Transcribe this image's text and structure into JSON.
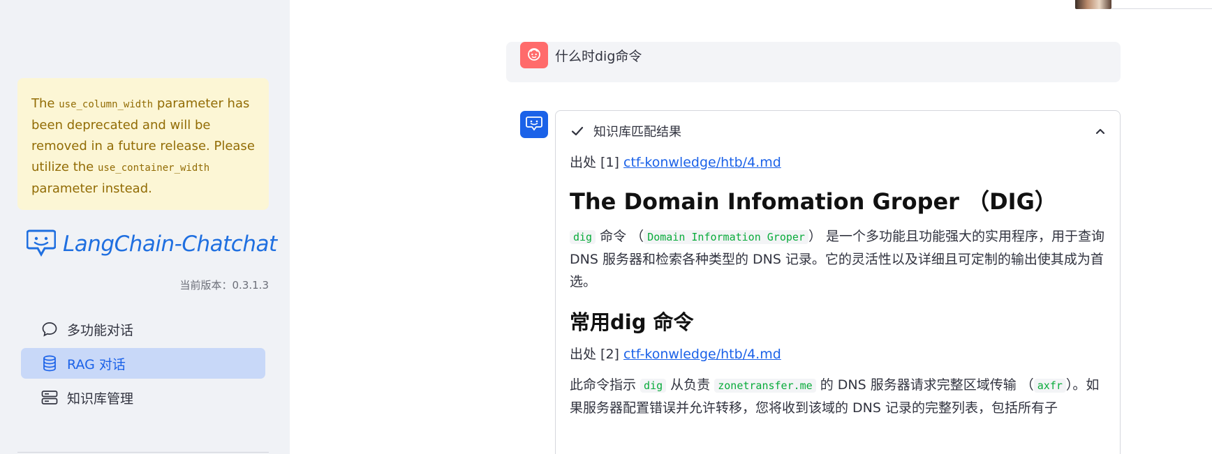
{
  "sidebar": {
    "warning": {
      "prefix": "The",
      "code1": "use_column_width",
      "middle": "parameter has been deprecated and will be removed in a future release. Please utilize the",
      "code2": "use_container_width",
      "suffix": "parameter instead."
    },
    "logo_text": "LangChain-Chatchat",
    "version": "当前版本：0.3.1.3",
    "nav": [
      {
        "label": "多功能对话",
        "icon": "chat-bubble-icon"
      },
      {
        "label": "RAG 对话",
        "icon": "database-icon"
      },
      {
        "label": "知识库管理",
        "icon": "server-stack-icon"
      }
    ],
    "active_index": 1
  },
  "chat": {
    "user_message": "什么时dig命令",
    "panel_title": "知识库匹配结果",
    "source1_prefix": "出处 [1]",
    "source1_link": "ctf-konwledge/htb/4.md",
    "heading1": "The Domain Infomation Groper （DIG）",
    "para1": {
      "code1": "dig",
      "t1": " 命令 （",
      "code2": "Domain Information Groper",
      "t2": "） 是一个多功能且功能强大的实用程序，用于查询 DNS 服务器和检索各种类型的 DNS 记录。它的灵活性以及详细且可定制的输出使其成为首选。"
    },
    "heading2": "常用dig 命令",
    "source2_prefix": "出处 [2]",
    "source2_link": "ctf-konwledge/htb/4.md",
    "para2": {
      "t1": "此命令指示 ",
      "code1": "dig",
      "t2": " 从负责 ",
      "code2": "zonetransfer.me",
      "t3": " 的 DNS 服务器请求完整区域传输 （",
      "code3": "axfr",
      "t4": "）。如果服务器配置错误并允许转移，您将收到该域的 DNS 记录的完整列表，包括所有子"
    }
  },
  "colors": {
    "accent": "#1b62e8",
    "user_avatar": "#ff6b6b",
    "warning_bg": "#fcf6d5",
    "warning_text": "#926c05",
    "code_text": "#09ab3b"
  }
}
